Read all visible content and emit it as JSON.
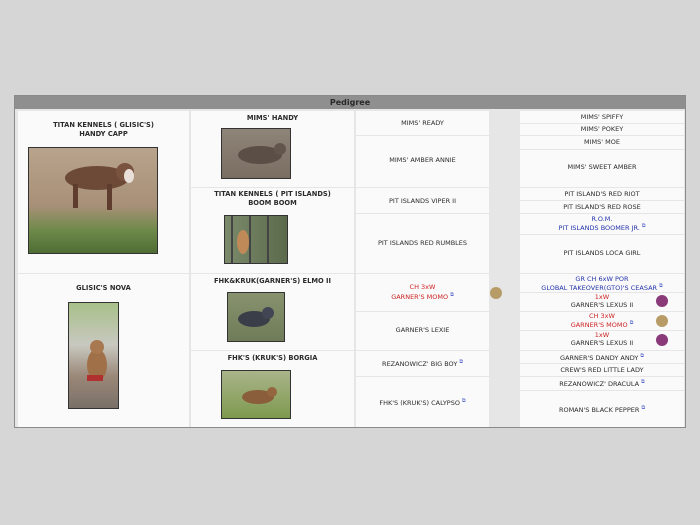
{
  "header": {
    "title": "Pedigree"
  },
  "gen1": {
    "sire": "TITAN KENNELS ( GLISIC'S)\nHANDY CAPP",
    "dam": "GLISIC'S NOVA"
  },
  "gen2": {
    "ss": "MIMS' HANDY",
    "sd": "TITAN KENNELS ( PIT ISLANDS)\nBOOM BOOM",
    "ds": "FHK&KRUK(GARNER'S) ELMO II",
    "dd": "FHK'S (KRUK'S) BORGIA"
  },
  "gen3": {
    "a": "MIMS' READY",
    "b": "MIMS' AMBER ANNIE",
    "c": "PIT ISLANDS VIPER II",
    "d": "PIT ISLANDS RED RUMBLES",
    "e_title": "CH 3xW",
    "e": "GARNER'S MOMO",
    "f": "GARNER'S LEXIE",
    "g": "REZANOWICZ' BIG BOY",
    "h": "FHK'S (KRUK'S) CALYPSO"
  },
  "gen4": {
    "r1": "MIMS' SPIFFY",
    "r2": "MIMS' POKEY",
    "r3": "MIMS' MOE",
    "r4": "MIMS' SWEET AMBER",
    "r5": "PIT ISLAND'S RED RIOT",
    "r6": "PIT ISLAND'S RED ROSE",
    "r7_title": "R.O.M.",
    "r7": "PIT ISLANDS BOOMER JR.",
    "r8": "PIT ISLANDS LOCA GIRL",
    "r9_title": "GR CH 6xW POR",
    "r9": "GLOBAL TAKEOVER(GTO)'S CEASAR",
    "r10_title": "1xW",
    "r10": "GARNER'S LEXUS II",
    "r11_title": "CH 3xW",
    "r11": "GARNER'S MOMO",
    "r12_title": "1xW",
    "r12": "GARNER'S LEXUS II",
    "r13": "GARNER'S DANDY ANDY",
    "r14": "CREW'S RED LITTLE LADY",
    "r15": "REZANOWICZ' DRACULA",
    "r16": "ROMAN'S BLACK PEPPER"
  },
  "colors": {
    "tan": "#b79c68",
    "purple": "#8a3a78",
    "red": "#cc2222",
    "blue": "#2233aa"
  }
}
